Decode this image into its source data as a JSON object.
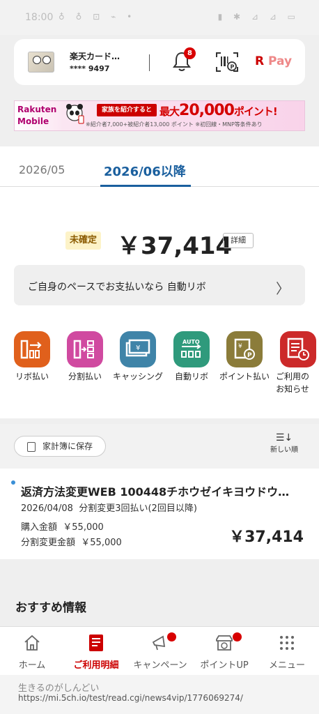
{
  "status_bar": {
    "time": "18:00",
    "left_icons": "♁ ♁ ⊡ ⌁ •",
    "right_icons": "▮ ✱ ⊿ ⊿ ▭"
  },
  "card": {
    "name": "楽天カード…",
    "number": "**** 9497",
    "notification_count": "8",
    "pay_logo_r": "R",
    "pay_logo_text": " Pay"
  },
  "banner": {
    "brand_line1": "Rakuten",
    "brand_line2": "Mobile",
    "pill_text": "家族を紹介すると",
    "headline_prefix": "最大",
    "headline_amount": "20,000",
    "headline_suffix": "ポイント!",
    "note": "※紹介者7,000+被紹介者13,000 ポイント ※初回線・MNP等条件あり"
  },
  "tabs": [
    {
      "label": "2026/05",
      "active": false
    },
    {
      "label": "2026/06以降",
      "active": true
    }
  ],
  "summary": {
    "status": "未確定",
    "amount": "￥37,414",
    "detail_label": "詳細"
  },
  "revo_banner": {
    "text": "ご自身のペースでお支払いなら 自動リボ"
  },
  "quick_actions": [
    {
      "label": "リボ払い",
      "icon": "revo-icon",
      "color": "#e0601c"
    },
    {
      "label": "分割払い",
      "icon": "installment-icon",
      "color": "#d04aa0"
    },
    {
      "label": "キャッシング",
      "icon": "cashing-icon",
      "color": "#3f84a8"
    },
    {
      "label": "自動リボ",
      "icon": "auto-revo-icon",
      "color": "#2f9a7c"
    },
    {
      "label": "ポイント払い",
      "icon": "point-pay-icon",
      "color": "#8b7c3a"
    },
    {
      "label": "ご利用の\nお知らせ",
      "icon": "usage-notice-icon",
      "color": "#cc2a2a"
    }
  ],
  "list_controls": {
    "save_label": "家計簿に保存",
    "sort_label": "新しい順"
  },
  "transaction": {
    "title": "返済方法変更WEB 100448チホウゼイキヨウドウ…",
    "date": "2026/04/08",
    "plan": "分割変更3回払い(2回目以降)",
    "purchase_label": "購入金額",
    "purchase_amount": "￥55,000",
    "changed_label": "分割変更金額",
    "changed_amount": "￥55,000",
    "amount": "￥37,414"
  },
  "recommend": {
    "title": "おすすめ情報"
  },
  "nav": [
    {
      "label": "ホーム",
      "icon": "home-icon",
      "active": false,
      "dot": false
    },
    {
      "label": "ご利用明細",
      "icon": "statement-icon",
      "active": true,
      "dot": false
    },
    {
      "label": "キャンペーン",
      "icon": "megaphone-icon",
      "active": false,
      "dot": true
    },
    {
      "label": "ポイントUP",
      "icon": "store-point-icon",
      "active": false,
      "dot": true
    },
    {
      "label": "メニュー",
      "icon": "grid-menu-icon",
      "active": false,
      "dot": false
    }
  ],
  "footer": {
    "line1": "生きるのがしんどい",
    "line2": "https://mi.5ch.io/test/read.cgi/news4vip/1776069274/"
  },
  "colors": {
    "brand_red": "#cc0000",
    "tab_blue": "#1a5f9e",
    "pending_bg": "#fdf3c8"
  }
}
